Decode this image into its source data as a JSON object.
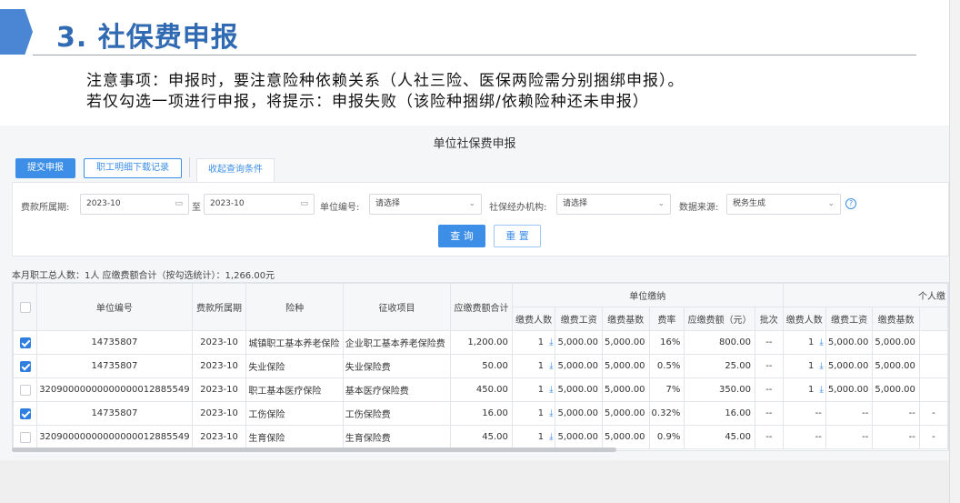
{
  "slide": {
    "title": "3. 社保费申报",
    "note1": "注意事项：申报时，要注意险种依赖关系（人社三险、医保两险需分别捆绑申报）。",
    "note2": "若仅勾选一项进行申报，将提示：申报失败（该险种捆绑/依赖险种还未申报）"
  },
  "app": {
    "title": "单位社保费申报",
    "submit_label": "提交申报",
    "download_label": "职工明细下载记录",
    "collapse_tab": "收起查询条件"
  },
  "filters": {
    "period_label": "费款所属期:",
    "period_start": "2023-10",
    "to_label": "至",
    "period_end": "2023-10",
    "unit_code_label": "单位编号:",
    "unit_code_value": "请选择",
    "agency_label": "社保经办机构:",
    "agency_value": "请选择",
    "source_label": "数据来源:",
    "source_value": "税务生成",
    "query_label": "查 询",
    "reset_label": "重 置"
  },
  "summary": "本月职工总人数：1人    应缴费额合计（按勾选统计）：1,266.00元",
  "table": {
    "headers": {
      "unit_code": "单位编号",
      "period": "费款所属期",
      "insurance": "险种",
      "item": "征收项目",
      "total": "应缴费额合计",
      "unit_group": "单位缴纳",
      "personal_group": "个人缴",
      "u_count": "缴费人数",
      "u_wage": "缴费工资",
      "u_base": "缴费基数",
      "u_rate": "费率",
      "u_amount": "应缴费额（元）",
      "u_batch": "批次",
      "p_count": "缴费人数",
      "p_wage": "缴费工资",
      "p_base": "缴费基数"
    },
    "rows": [
      {
        "checked": true,
        "unit_code": "14735807",
        "period": "2023-10",
        "insurance": "城镇职工基本养老保险",
        "item": "企业职工基本养老保险费",
        "total": "1,200.00",
        "u_count": "1",
        "u_wage": "5,000.00",
        "u_base": "5,000.00",
        "u_rate": "16%",
        "u_amount": "800.00",
        "u_batch": "--",
        "p_count": "1",
        "p_dl": true,
        "p_wage": "5,000.00",
        "p_base": "5,000.00",
        "p_extra": ""
      },
      {
        "checked": true,
        "unit_code": "14735807",
        "period": "2023-10",
        "insurance": "失业保险",
        "item": "失业保险费",
        "total": "50.00",
        "u_count": "1",
        "u_wage": "5,000.00",
        "u_base": "5,000.00",
        "u_rate": "0.5%",
        "u_amount": "25.00",
        "u_batch": "--",
        "p_count": "1",
        "p_dl": true,
        "p_wage": "5,000.00",
        "p_base": "5,000.00",
        "p_extra": ""
      },
      {
        "checked": false,
        "unit_code": "32090000000000000012885549",
        "period": "2023-10",
        "insurance": "职工基本医疗保险",
        "item": "基本医疗保险费",
        "total": "450.00",
        "u_count": "1",
        "u_wage": "5,000.00",
        "u_base": "5,000.00",
        "u_rate": "7%",
        "u_amount": "350.00",
        "u_batch": "--",
        "p_count": "1",
        "p_dl": true,
        "p_wage": "5,000.00",
        "p_base": "5,000.00",
        "p_extra": ""
      },
      {
        "checked": true,
        "unit_code": "14735807",
        "period": "2023-10",
        "insurance": "工伤保险",
        "item": "工伤保险费",
        "total": "16.00",
        "u_count": "1",
        "u_wage": "5,000.00",
        "u_base": "5,000.00",
        "u_rate": "0.32%",
        "u_amount": "16.00",
        "u_batch": "--",
        "p_count": "--",
        "p_dl": false,
        "p_wage": "--",
        "p_base": "--",
        "p_extra": "-"
      },
      {
        "checked": false,
        "unit_code": "32090000000000000012885549",
        "period": "2023-10",
        "insurance": "生育保险",
        "item": "生育保险费",
        "total": "45.00",
        "u_count": "1",
        "u_wage": "5,000.00",
        "u_base": "5,000.00",
        "u_rate": "0.9%",
        "u_amount": "45.00",
        "u_batch": "--",
        "p_count": "--",
        "p_dl": false,
        "p_wage": "--",
        "p_base": "--",
        "p_extra": "-"
      }
    ]
  }
}
